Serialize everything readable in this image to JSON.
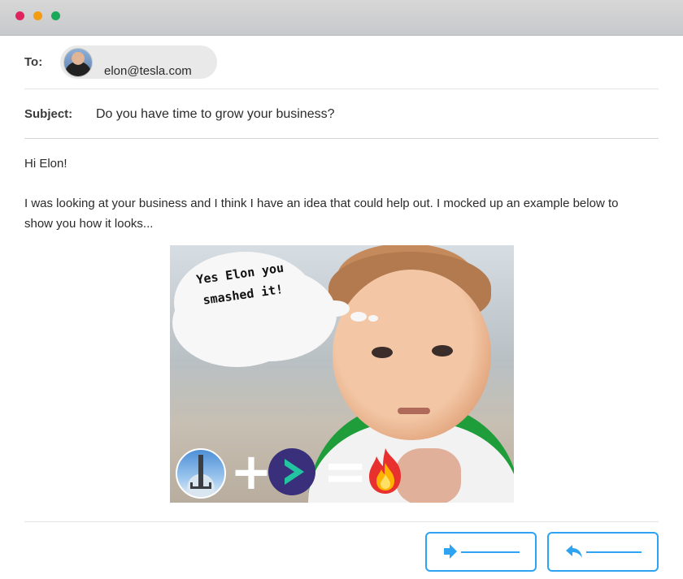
{
  "window": {
    "controls": [
      "close",
      "minimize",
      "maximize"
    ],
    "colors": {
      "close": "#e0245e",
      "minimize": "#f39c12",
      "maximize": "#1aa85a"
    }
  },
  "email": {
    "to_label": "To:",
    "recipient_email": "elon@tesla.com",
    "subject_label": "Subject:",
    "subject": "Do you have time to grow your business?",
    "greeting": "Hi Elon!",
    "body": "I was looking at your business and I think I have an idea that could help out. I mocked up an example below to show you how it looks..."
  },
  "meme": {
    "caption_lines": [
      "Yes Elon you",
      "smashed it!"
    ],
    "equation_icons": [
      "rocket-icon",
      "plus-sign",
      "play-logo-icon",
      "equals-sign",
      "fire-icon"
    ]
  },
  "actions": {
    "forward_icon": "forward-arrow-icon",
    "reply_icon": "reply-arrow-icon",
    "accent_color": "#2ea3f2"
  }
}
